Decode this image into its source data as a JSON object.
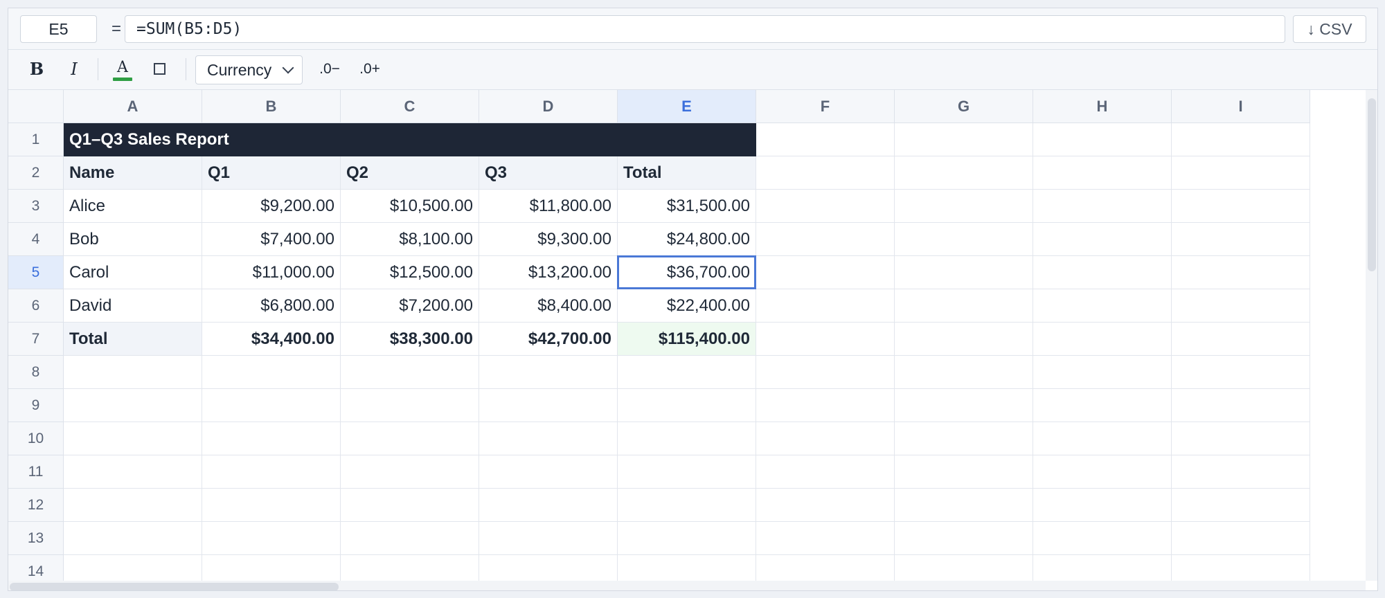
{
  "formula_bar": {
    "cell_ref": "E5",
    "equals": "=",
    "formula": "=SUM(B5:D5)",
    "csv_label": "↓ CSV"
  },
  "toolbar": {
    "bold": "B",
    "italic": "I",
    "text_color_glyph": "A",
    "text_color": "#2f9e44",
    "number_format": "Currency",
    "decrease_decimals": ".0−",
    "increase_decimals": ".0+"
  },
  "grid": {
    "columns": [
      "A",
      "B",
      "C",
      "D",
      "E",
      "F",
      "G",
      "H",
      "I"
    ],
    "rows": [
      "1",
      "2",
      "3",
      "4",
      "5",
      "6",
      "7",
      "8",
      "9",
      "10",
      "11",
      "12",
      "13",
      "14"
    ],
    "active_cell": {
      "column": "E",
      "row": "5"
    },
    "title": "Q1–Q3 Sales Report",
    "header": [
      "Name",
      "Q1",
      "Q2",
      "Q3",
      "Total"
    ],
    "data": [
      [
        "Alice",
        "$9,200.00",
        "$10,500.00",
        "$11,800.00",
        "$31,500.00"
      ],
      [
        "Bob",
        "$7,400.00",
        "$8,100.00",
        "$9,300.00",
        "$24,800.00"
      ],
      [
        "Carol",
        "$11,000.00",
        "$12,500.00",
        "$13,200.00",
        "$36,700.00"
      ],
      [
        "David",
        "$6,800.00",
        "$7,200.00",
        "$8,400.00",
        "$22,400.00"
      ]
    ],
    "totals": [
      "Total",
      "$34,400.00",
      "$38,300.00",
      "$42,700.00",
      "$115,400.00"
    ]
  },
  "colors": {
    "title_bg": "#1e2636",
    "selection": "#4a78d6",
    "grand_total_bg": "#eefaf0"
  }
}
